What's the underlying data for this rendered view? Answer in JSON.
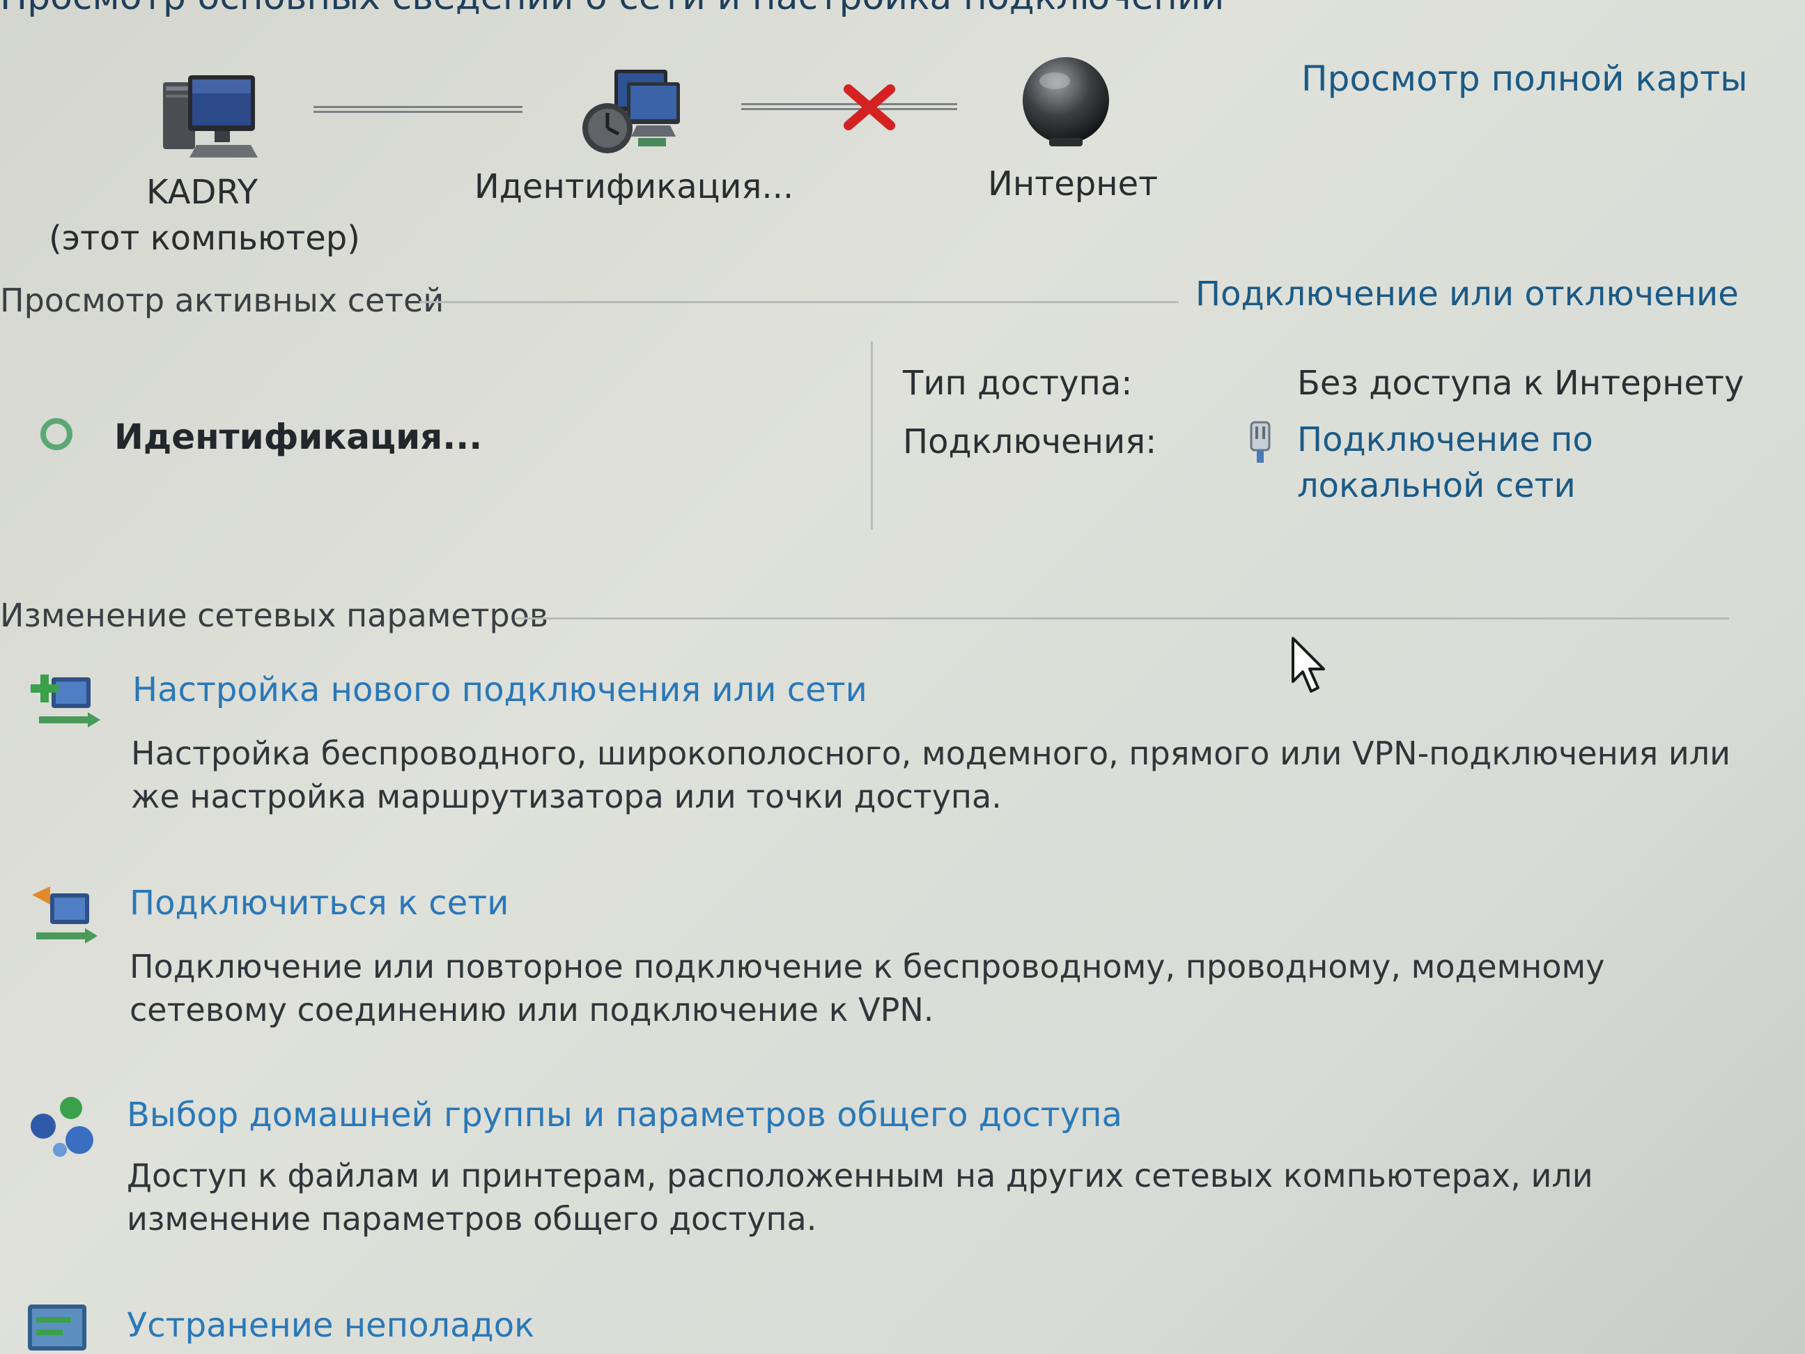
{
  "header": {
    "title": "Просмотр основных сведений о сети и настройка подключений",
    "full_map_link": "Просмотр полной карты"
  },
  "network_map": {
    "computer_name": "KADRY",
    "computer_sub": "(этот компьютер)",
    "network_label": "Идентификация...",
    "internet_label": "Интернет",
    "connection_to_internet_status": "disconnected"
  },
  "active_networks": {
    "title": "Просмотр активных сетей",
    "connect_link": "Подключение или отключение",
    "network_name": "Идентификация...",
    "access_type_label": "Тип доступа:",
    "access_type_value": "Без доступа к Интернету",
    "connections_label": "Подключения:",
    "connections_value": "Подключение по локальной сети"
  },
  "change_settings": {
    "title": "Изменение сетевых параметров",
    "tasks": [
      {
        "icon": "new-connection-icon",
        "title": "Настройка нового подключения или сети",
        "description": "Настройка беспроводного, широкополосного, модемного, прямого или VPN-подключения или же настройка маршрутизатора или точки доступа."
      },
      {
        "icon": "connect-network-icon",
        "title": "Подключиться к сети",
        "description": "Подключение или повторное подключение к беспроводному, проводному, модемному сетевому соединению или подключение к VPN."
      },
      {
        "icon": "homegroup-icon",
        "title": "Выбор домашней группы и параметров общего доступа",
        "description": "Доступ к файлам и принтерам, расположенным на других сетевых компьютерах, или изменение параметров общего доступа."
      },
      {
        "icon": "troubleshoot-icon",
        "title": "Устранение неполадок",
        "description": ""
      }
    ]
  },
  "colors": {
    "link": "#1b5a86",
    "task_link": "#2a78b8",
    "status_ring": "#5aa872",
    "error_x": "#d42222"
  }
}
